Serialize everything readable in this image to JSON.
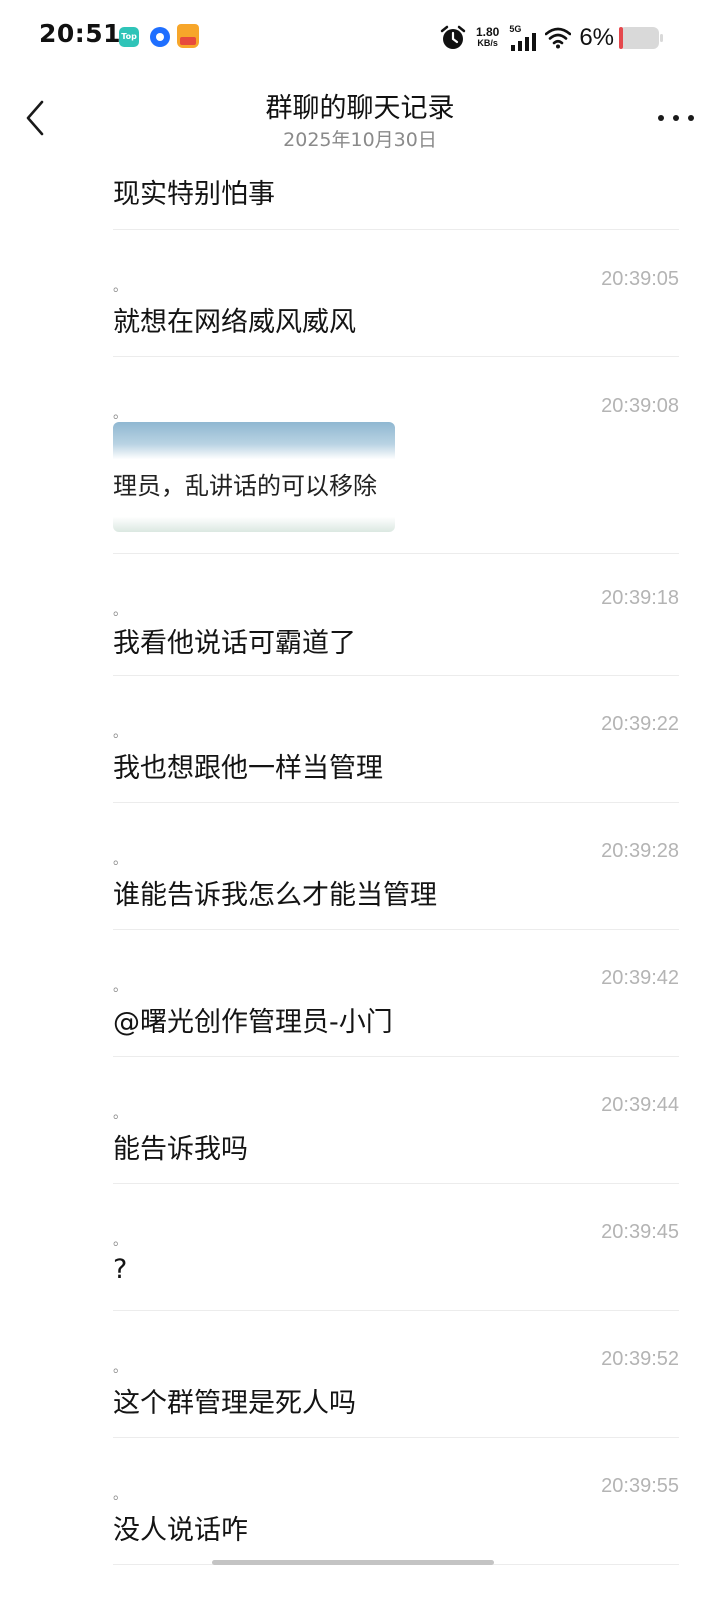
{
  "status_bar": {
    "time": "20:51",
    "notification_icons": [
      "top-app-icon",
      "circle-app-icon",
      "shopping-bag-app-icon"
    ],
    "alarm_icon": "alarm-icon",
    "net_speed_value": "1.80",
    "net_speed_unit": "KB/s",
    "network_type": "5G",
    "battery_percent": "6%",
    "colors": {
      "battery_low": "#e5484d"
    }
  },
  "header": {
    "back_icon": "chevron-left-icon",
    "title": "群聊的聊天记录",
    "subtitle": "2025年10月30日",
    "more_icon": "more-horizontal-icon"
  },
  "messages": [
    {
      "sender": "。",
      "time": "",
      "text": "现实特别怕事"
    },
    {
      "sender": "。",
      "time": "20:39:05",
      "text": "就想在网络威风威风"
    },
    {
      "sender": "。",
      "time": "20:39:08",
      "type": "image",
      "image_text": "理员，乱讲话的可以移除"
    },
    {
      "sender": "。",
      "time": "20:39:18",
      "text": "我看他说话可霸道了"
    },
    {
      "sender": "。",
      "time": "20:39:22",
      "text": "我也想跟他一样当管理"
    },
    {
      "sender": "。",
      "time": "20:39:28",
      "text": "谁能告诉我怎么才能当管理"
    },
    {
      "sender": "。",
      "time": "20:39:42",
      "text": "@曙光创作管理员-小门"
    },
    {
      "sender": "。",
      "time": "20:39:44",
      "text": "能告诉我吗"
    },
    {
      "sender": "。",
      "time": "20:39:45",
      "text": "?"
    },
    {
      "sender": "。",
      "time": "20:39:52",
      "text": "这个群管理是死人吗"
    },
    {
      "sender": "。",
      "time": "20:39:55",
      "text": "没人说话咋"
    }
  ]
}
